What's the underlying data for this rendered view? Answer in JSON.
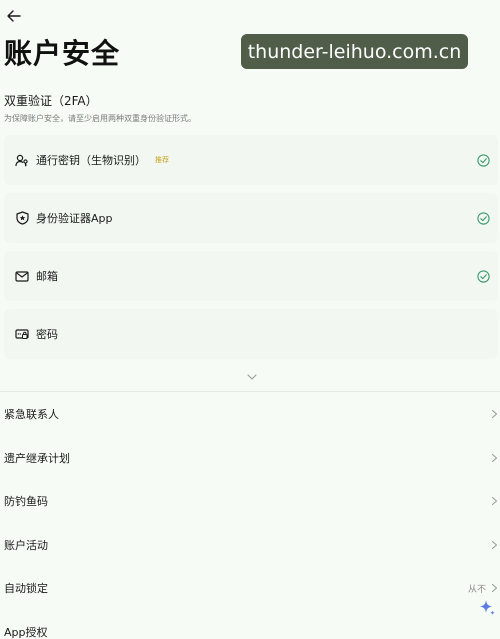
{
  "header": {
    "title": "账户安全"
  },
  "watermark": {
    "text": "thunder-leihuo.com.cn"
  },
  "twofa": {
    "title": "双重验证（2FA）",
    "description": "为保障账户安全，请至少启用两种双重身份验证形式。",
    "items": [
      {
        "label": "通行密钥（生物识别）",
        "badge": "推荐",
        "icon": "passkey-icon",
        "enabled": true
      },
      {
        "label": "身份验证器App",
        "icon": "authenticator-icon",
        "enabled": true
      },
      {
        "label": "邮箱",
        "icon": "email-icon",
        "enabled": true
      },
      {
        "label": "密码",
        "icon": "password-icon",
        "enabled": false
      }
    ]
  },
  "settings": [
    {
      "label": "紧急联系人"
    },
    {
      "label": "遗产继承计划"
    },
    {
      "label": "防钓鱼码"
    },
    {
      "label": "账户活动"
    },
    {
      "label": "自动锁定",
      "value": "从不"
    },
    {
      "label": "App授权"
    }
  ],
  "colors": {
    "check": "#3a9a6c",
    "badge": "#c9a224",
    "background": "#f7fbf6",
    "card": "#f2f8f1"
  }
}
